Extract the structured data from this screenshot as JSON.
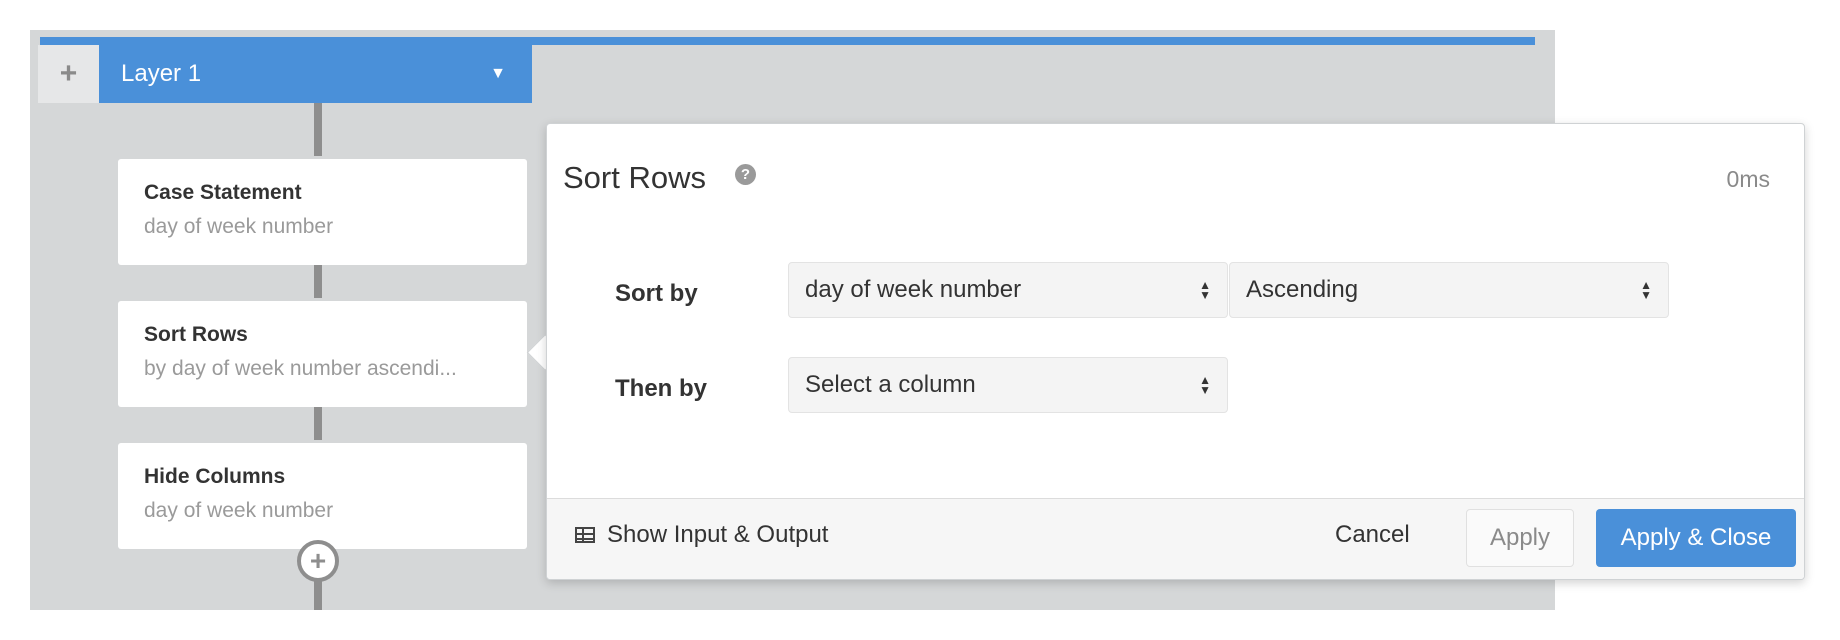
{
  "layer": {
    "add_icon": "plus-icon",
    "tab_label": "Layer 1",
    "tab_caret": "▼"
  },
  "steps": [
    {
      "title": "Case Statement",
      "subtitle": "day of week number"
    },
    {
      "title": "Sort Rows",
      "subtitle": "by day of week number ascendi..."
    },
    {
      "title": "Hide Columns",
      "subtitle": "day of week number"
    }
  ],
  "add_step_icon": "+",
  "panel": {
    "title": "Sort Rows",
    "help_icon": "?",
    "timing": "0ms",
    "sort_by_label": "Sort by",
    "sort_by_column": "day of week number",
    "sort_by_direction": "Ascending",
    "then_by_label": "Then by",
    "then_by_placeholder": "Select a column",
    "show_io_label": "Show Input & Output",
    "cancel_label": "Cancel",
    "apply_label": "Apply",
    "apply_close_label": "Apply & Close"
  },
  "colors": {
    "accent": "#4a90d9",
    "canvas": "#d5d7d8"
  }
}
